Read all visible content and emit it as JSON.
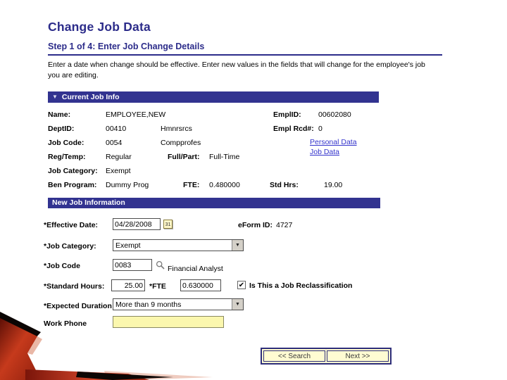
{
  "colors": {
    "navy": "#323390",
    "heading": "#2c2c8a",
    "link": "#3333cc",
    "button-face": "#fffcd2",
    "button-border": "#2e2e7a",
    "input-yellow": "#fbf7ae",
    "accent-red": "#c23a1c"
  },
  "page": {
    "title": "Change Job Data",
    "step_heading": "Step 1 of 4: Enter Job Change Details",
    "instructions_line1": "Enter a date when change should be effective. Enter new values in the fields that will change for the employee's job",
    "instructions_line2": "you are editing."
  },
  "icons": {
    "collapse": "▼",
    "dropdown": "▼",
    "check": "✔",
    "calendar_day": "31"
  },
  "current_job": {
    "header": "Current Job Info",
    "name": {
      "label": "Name:",
      "value": "EMPLOYEE,NEW"
    },
    "emplid": {
      "label": "EmplID:",
      "value": "00602080"
    },
    "deptid": {
      "label": "DeptID:",
      "value": "00410",
      "desc": "Hmnrsrcs"
    },
    "empl_rcd": {
      "label": "Empl Rcd#:",
      "value": "0"
    },
    "job_code": {
      "label": "Job Code:",
      "value": "0054",
      "desc": "Compprofes"
    },
    "links": {
      "personal_data": "Personal Data",
      "job_data": "Job Data"
    },
    "reg_temp": {
      "label": "Reg/Temp:",
      "value": "Regular"
    },
    "full_part": {
      "label": "Full/Part:",
      "value": "Full-Time"
    },
    "job_category": {
      "label": "Job Category:",
      "value": "Exempt"
    },
    "ben_program": {
      "label": "Ben Program:",
      "value": "Dummy Prog"
    },
    "fte": {
      "label": "FTE:",
      "value": "0.480000"
    },
    "std_hrs": {
      "label": "Std Hrs:",
      "value": "19.00"
    }
  },
  "new_job": {
    "header": "New Job Information",
    "effective_date": {
      "label": "*Effective Date:",
      "value": "04/28/2008"
    },
    "eform": {
      "label": "eForm ID:",
      "value": "4727"
    },
    "job_category": {
      "label": "*Job Category:",
      "value": "Exempt"
    },
    "job_code": {
      "label": "*Job Code",
      "value": "0083",
      "desc": "Financial Analyst"
    },
    "standard_hours": {
      "label": "*Standard Hours:",
      "value": "25.00"
    },
    "fte": {
      "label": "*FTE",
      "value": "0.630000"
    },
    "reclassification": {
      "label": "Is This a Job Reclassification",
      "checked": true
    },
    "expected_duration": {
      "label": "*Expected Duration",
      "value": "More than 9 months"
    },
    "work_phone": {
      "label": "Work Phone",
      "value": ""
    }
  },
  "buttons": {
    "search": "<< Search",
    "next": "Next >>"
  }
}
